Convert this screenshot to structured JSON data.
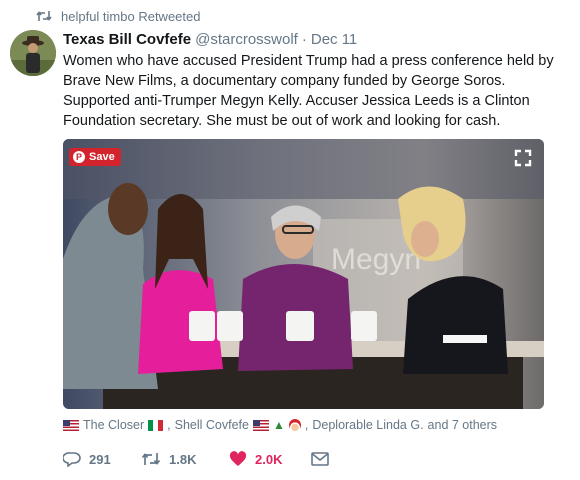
{
  "retweet_context": {
    "icon": "retweet-icon",
    "text": "helpful timbo Retweeted"
  },
  "tweet": {
    "author_name": "Texas Bill Covfefe",
    "handle": "@starcrosswolf",
    "separator": "·",
    "date": "Dec 11",
    "text": "Women who have accused President Trump had a press conference held by Brave New Films, a documentary company funded by George Soros. Supported anti-Trumper Megyn Kelly. Accuser Jessica Leeds is a Clinton Foundation secretary. She must be out of work and looking for cash."
  },
  "media": {
    "save_label": "Save",
    "save_icon": "pinterest-icon",
    "expand_icon": "expand-icon",
    "background_text": "Megyn"
  },
  "likers": {
    "names": [
      "The Closer",
      "Shell Covfefe",
      "Deplorable Linda G."
    ],
    "separator": ",",
    "suffix": "and 7 others"
  },
  "actions": {
    "reply_count": "291",
    "retweet_count": "1.8K",
    "like_count": "2.0K",
    "reply_icon": "reply-icon",
    "retweet_icon": "retweet-icon",
    "like_icon": "heart-icon",
    "dm_icon": "envelope-icon"
  },
  "colors": {
    "like_active": "#e0245e",
    "muted_text": "#657786",
    "pinterest_red": "#d3242d"
  }
}
